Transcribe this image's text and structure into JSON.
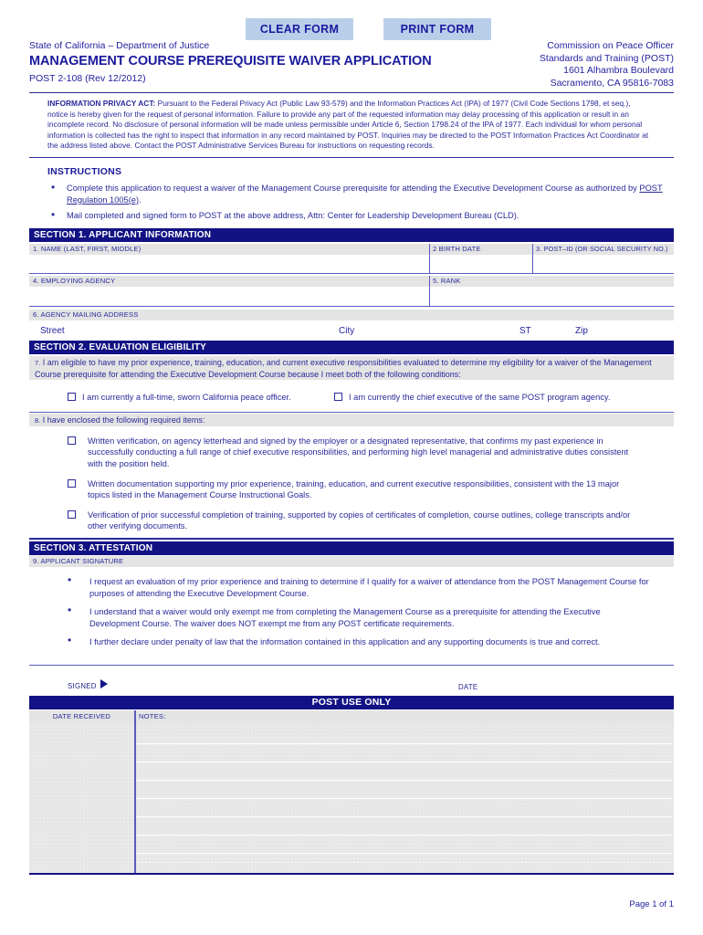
{
  "toolbar": {
    "clear_form": "CLEAR FORM",
    "print_form": "PRINT FORM"
  },
  "header": {
    "state_line": "State of California – Department of Justice",
    "title": "MANAGEMENT COURSE PREREQUISITE WAIVER APPLICATION",
    "form_number": "POST 2-108 (Rev 12/2012)",
    "agency_lines": [
      "Commission on Peace Officer",
      "Standards and Training (POST)",
      "1601 Alhambra Boulevard",
      "Sacramento, CA 95816-7083"
    ]
  },
  "privacy": {
    "heading": "INFORMATION PRIVACY ACT:",
    "body": "  Pursuant to the Federal Privacy Act (Public Law 93-579) and the Information Practices Act (IPA) of 1977 (Civil Code Sections 1798, et seq.), notice is hereby given for the request of personal information. Failure to provide any part of the requested information may delay processing of this application or result in an incomplete record. No disclosure of personal information will be made unless permissible under Article 6, Section 1798.24 of the IPA of 1977. Each individual for whom personal information is collected has the right to inspect that information in any record maintained by POST. Inquiries may be directed to the POST Information Practices Act Coordinator at the address listed above. Contact the POST Administrative Services Bureau for instructions on requesting records."
  },
  "instructions": {
    "title": "INSTRUCTIONS",
    "items": [
      {
        "pre": "Complete this application to request a waiver of the Management Course prerequisite for attending the Executive Development Course as authorized by ",
        "link": "POST Regulation 1005(e)",
        "post": "."
      },
      {
        "pre": "Mail completed and signed form to POST at the above address, Attn: Center for Leadership Development Bureau (CLD).",
        "link": "",
        "post": ""
      }
    ]
  },
  "section1": {
    "bar": "SECTION 1.   APPLICANT INFORMATION",
    "fields": {
      "name": "1.  NAME  (LAST, FIRST, MIDDLE)",
      "birth_date": "2  BIRTH DATE",
      "post_id": "3. POST–ID (OR SOCIAL SECURITY NO.)",
      "employing_agency": "4.  EMPLOYING AGENCY",
      "rank": "5.  RANK",
      "mailing_address": "6.  AGENCY MAILING ADDRESS"
    },
    "address_labels": {
      "street": "Street",
      "city": "City",
      "state": "ST",
      "zip": "Zip"
    }
  },
  "section2": {
    "bar": "SECTION 2.   EVALUATION ELIGIBILITY",
    "item7_num": "7.",
    "item7_text": " I am eligible to have my prior experience, training, education, and current executive responsibilities evaluated to determine my eligibility for a waiver of the Management Course prerequisite for attending the Executive Development Course because I meet both of the following conditions:",
    "condition_a": "I am currently a full-time, sworn California peace officer.",
    "condition_b": "I am currently the chief executive of the same POST program agency.",
    "item8_num": "8.",
    "item8_text": " I have enclosed the following required items:",
    "required_items": [
      "Written verification, on agency letterhead and signed by the employer or a designated representative, that confirms my past experience in successfully conducting a full range of chief executive responsibilities, and performing high level managerial and administrative duties consistent with the position held.",
      "Written documentation supporting my prior experience, training, education, and current executive responsibilities, consistent with the 13 major topics listed in the Management Course Instructional Goals.",
      "Verification of prior successful completion of training, supported by copies of certificates of completion, course outlines, college transcripts and/or other verifying documents."
    ]
  },
  "section3": {
    "bar": "SECTION 3.   ATTESTATION",
    "signature_label": "9.  APPLICANT SIGNATURE",
    "statements": [
      "I request an evaluation of my prior experience and training to determine if I qualify for a waiver of attendance from the POST Management Course for purposes of attending the Executive Development Course.",
      "I understand that a waiver would only exempt me from completing the Management Course as a prerequisite for attending the Executive Development Course. The waiver does NOT exempt me from any POST certificate requirements.",
      "I further declare under penalty of law that the information contained in this application and any supporting documents is true and correct."
    ],
    "signed_label": "SIGNED",
    "date_label": "DATE"
  },
  "post_use": {
    "bar": "POST USE ONLY",
    "date_received": "DATE RECEIVED",
    "notes": "NOTES:"
  },
  "footer": {
    "page": "Page 1 of 1"
  },
  "colors": {
    "section_bar": "#121284",
    "text_blue": "#2a2a9b",
    "button_fill": "#b9cfe9",
    "label_band": "#e4e4e4"
  }
}
